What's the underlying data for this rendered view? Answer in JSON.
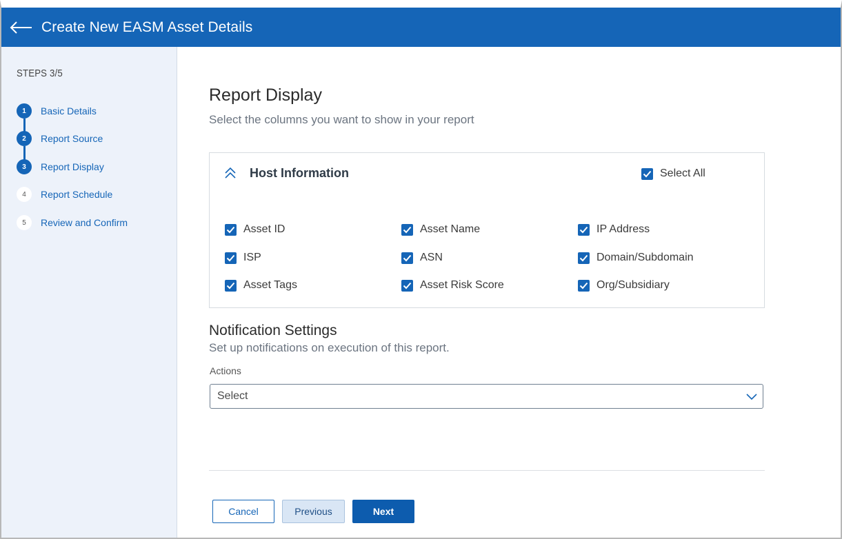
{
  "header": {
    "title": "Create New EASM Asset Details",
    "back_icon": "arrow-left-icon",
    "background_color": "#1565b7"
  },
  "sidebar": {
    "steps_label": "STEPS 3/5",
    "steps": [
      {
        "number": "1",
        "label": "Basic Details",
        "state": "done"
      },
      {
        "number": "2",
        "label": "Report Source",
        "state": "done"
      },
      {
        "number": "3",
        "label": "Report Display",
        "state": "current"
      },
      {
        "number": "4",
        "label": "Report Schedule",
        "state": "todo"
      },
      {
        "number": "5",
        "label": "Review and Confirm",
        "state": "todo"
      }
    ]
  },
  "main": {
    "title": "Report Display",
    "subtitle": "Select the columns you want to show in your report",
    "host_information": {
      "title": "Host Information",
      "collapse_icon": "chevron-double-up-icon",
      "select_all_label": "Select All",
      "select_all_checked": true,
      "columns": [
        {
          "label": "Asset ID",
          "checked": true
        },
        {
          "label": "Asset Name",
          "checked": true
        },
        {
          "label": "IP Address",
          "checked": true
        },
        {
          "label": "ISP",
          "checked": true
        },
        {
          "label": "ASN",
          "checked": true
        },
        {
          "label": "Domain/Subdomain",
          "checked": true
        },
        {
          "label": "Asset Tags",
          "checked": true
        },
        {
          "label": "Asset Risk Score",
          "checked": true
        },
        {
          "label": "Org/Subsidiary",
          "checked": true
        }
      ]
    },
    "notification": {
      "title": "Notification Settings",
      "subtitle": "Set up notifications on execution of this report.",
      "actions_label": "Actions",
      "actions_value": "Select"
    },
    "buttons": {
      "cancel": "Cancel",
      "previous": "Previous",
      "next": "Next"
    }
  },
  "colors": {
    "accent": "#1565b7",
    "sidebar_bg": "#edf2fa"
  }
}
